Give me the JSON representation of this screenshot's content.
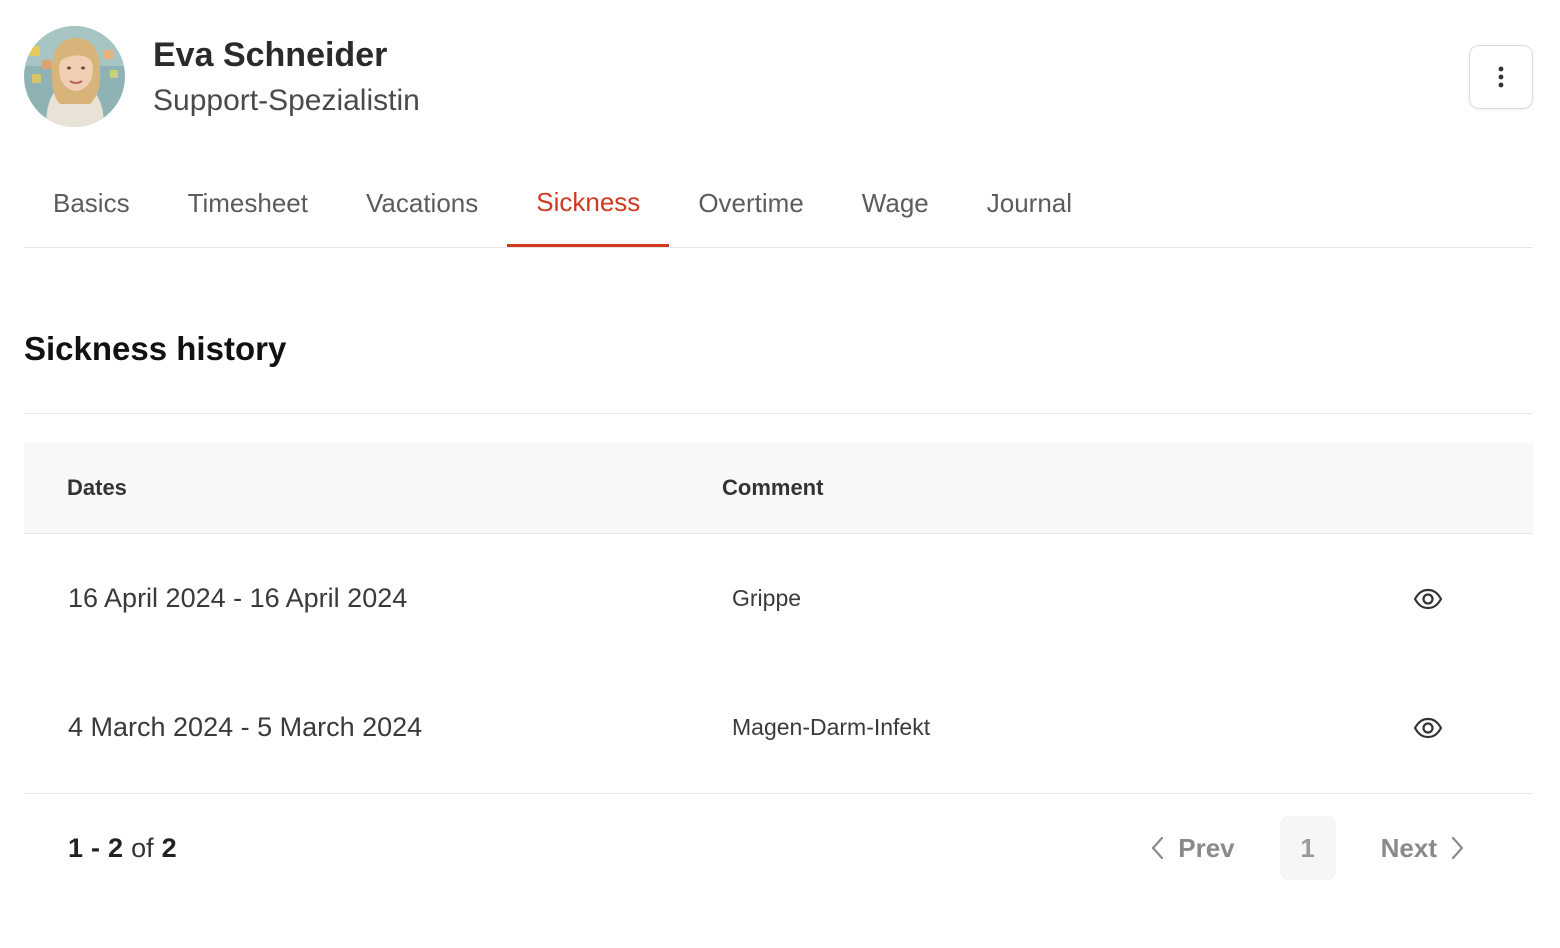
{
  "profile": {
    "name": "Eva Schneider",
    "job_title": "Support-Spezialistin",
    "more_icon": "vertical-dots-icon"
  },
  "tabs": [
    {
      "label": "Basics",
      "active": false
    },
    {
      "label": "Timesheet",
      "active": false
    },
    {
      "label": "Vacations",
      "active": false
    },
    {
      "label": "Sickness",
      "active": true
    },
    {
      "label": "Overtime",
      "active": false
    },
    {
      "label": "Wage",
      "active": false
    },
    {
      "label": "Journal",
      "active": false
    }
  ],
  "section": {
    "title": "Sickness history"
  },
  "table": {
    "columns": {
      "dates": "Dates",
      "comment": "Comment"
    },
    "rows": [
      {
        "dates": "16 April 2024 - 16 April 2024",
        "comment": "Grippe",
        "action_icon": "eye-icon"
      },
      {
        "dates": "4 March 2024 - 5 March 2024",
        "comment": "Magen-Darm-Infekt",
        "action_icon": "eye-icon"
      }
    ]
  },
  "pagination": {
    "range_start": "1",
    "range_separator": "-",
    "range_end": "2",
    "of_label": "of",
    "total": "2",
    "prev_label": "Prev",
    "current_page": "1",
    "next_label": "Next"
  },
  "colors": {
    "accent": "#d0391e",
    "header_bg": "#f8f8f8",
    "divider": "#e6e6e6"
  }
}
